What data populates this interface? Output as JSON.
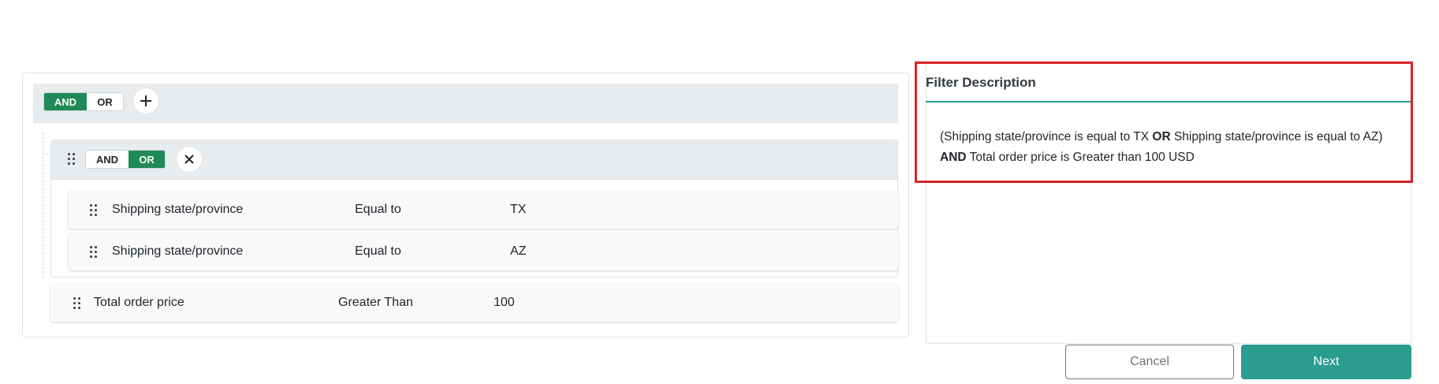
{
  "builder": {
    "root": {
      "and_label": "AND",
      "or_label": "OR",
      "active": "AND",
      "add_icon": "plus-icon"
    },
    "group": {
      "and_label": "AND",
      "or_label": "OR",
      "active": "OR",
      "remove_icon": "close-icon",
      "rules": [
        {
          "field": "Shipping state/province",
          "operator": "Equal to",
          "value": "TX"
        },
        {
          "field": "Shipping state/province",
          "operator": "Equal to",
          "value": "AZ"
        }
      ]
    },
    "rules": [
      {
        "field": "Total order price",
        "operator": "Greater Than",
        "value": "100"
      }
    ]
  },
  "description": {
    "title": "Filter Description",
    "line1_a": "(Shipping state/province is equal to TX ",
    "line1_op": "OR",
    "line1_b": " Shipping state/province is equal to AZ)",
    "line2_op": "AND",
    "line2_b": " Total order price is Greater than 100 USD"
  },
  "actions": {
    "cancel_label": "Cancel",
    "next_label": "Next"
  },
  "colors": {
    "toggle_active": "#1e8a55",
    "primary": "#2a9d8f",
    "highlight": "#d8232a"
  }
}
